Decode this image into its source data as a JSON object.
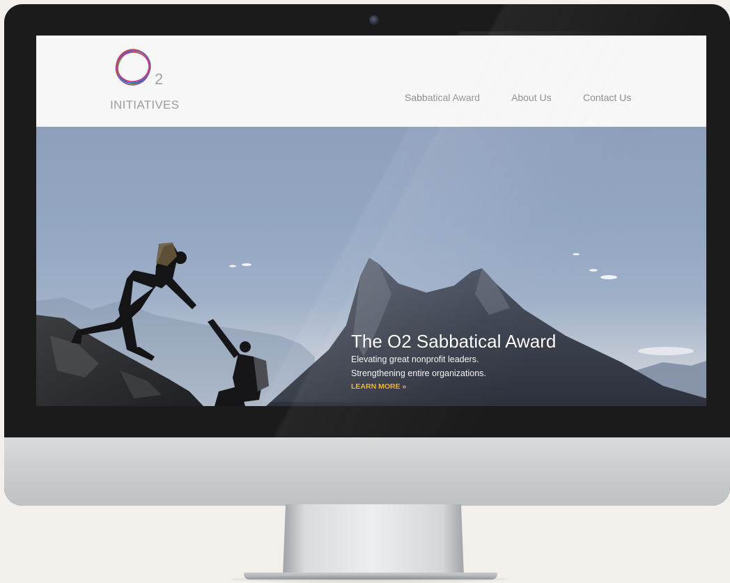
{
  "brand": {
    "logo_sub": "2",
    "logo_word": "INITIATIVES"
  },
  "nav": {
    "items": [
      {
        "label": "Sabbatical Award"
      },
      {
        "label": "About Us"
      },
      {
        "label": "Contact Us"
      }
    ]
  },
  "hero": {
    "title": "The O2 Sabbatical Award",
    "line1": "Elevating great nonprofit leaders.",
    "line2": "Strengthening entire organizations.",
    "cta": "LEARN MORE »"
  },
  "colors": {
    "cta_accent": "#e7b22a",
    "nav_text": "#8b8d90",
    "header_bg": "#f7f7f7"
  },
  "icons": {
    "logo_mark": "o2-rings-logo",
    "camera": "webcam-dot"
  }
}
